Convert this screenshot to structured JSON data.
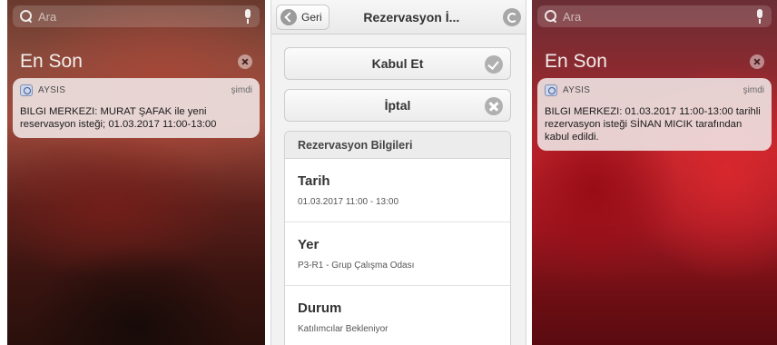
{
  "left_screen": {
    "search": {
      "placeholder": "Ara"
    },
    "section_title": "En Son",
    "notification": {
      "app_name": "AYSIS",
      "time": "şimdi",
      "body": "BILGI MERKEZI: MURAT ŞAFAK ile yeni reservasyon isteği; 01.03.2017 11:00-13:00"
    }
  },
  "app_screen": {
    "nav": {
      "back_label": "Geri",
      "title": "Rezervasyon İ..."
    },
    "buttons": {
      "accept_label": "Kabul Et",
      "cancel_label": "İptal"
    },
    "info": {
      "header": "Rezervasyon Bilgileri",
      "items": [
        {
          "label": "Tarih",
          "value": "01.03.2017 11:00 - 13:00"
        },
        {
          "label": "Yer",
          "value": "P3-R1 - Grup Çalışma Odası"
        },
        {
          "label": "Durum",
          "value": "Katılımcılar Bekleniyor"
        }
      ]
    }
  },
  "right_screen": {
    "search": {
      "placeholder": "Ara"
    },
    "section_title": "En Son",
    "notification": {
      "app_name": "AYSIS",
      "time": "şimdi",
      "body": "BILGI MERKEZI: 01.03.2017 11:00-13:00 tarihli rezervasyon isteği SİNAN MICIK tarafından kabul edildi."
    }
  },
  "icons": {
    "search": "search-icon",
    "mic": "mic-icon",
    "clear": "clear-icon",
    "app": "aysis-app-icon",
    "back": "back-arrow-icon",
    "refresh": "refresh-icon",
    "accept": "check-icon",
    "cancel": "x-icon"
  }
}
